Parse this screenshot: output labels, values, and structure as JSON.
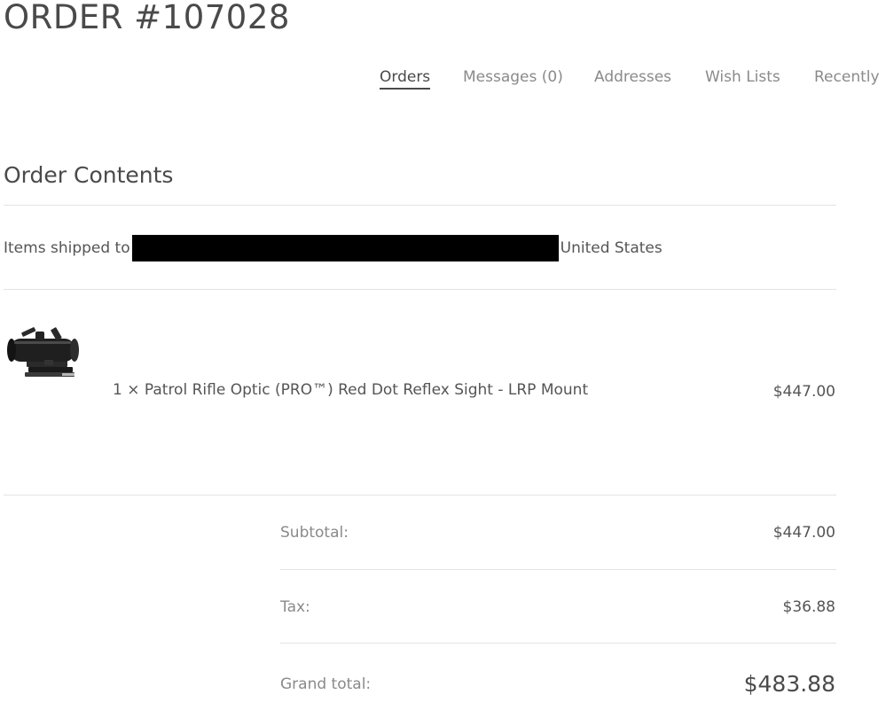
{
  "page": {
    "title": "ORDER #107028"
  },
  "account_nav": {
    "items": [
      {
        "label": "Orders",
        "active": true
      },
      {
        "label": "Messages (0)",
        "active": false
      },
      {
        "label": "Addresses",
        "active": false
      },
      {
        "label": "Wish Lists",
        "active": false
      },
      {
        "label": "Recently",
        "active": false
      }
    ]
  },
  "order_contents": {
    "heading": "Order Contents",
    "shipped_to_label": "Items shipped to",
    "shipped_to_country": "United States",
    "address_redacted": true,
    "items": [
      {
        "quantity_name": "1 × Patrol Rifle Optic (PRO™) Red Dot Reflex Sight - LRP Mount",
        "price": "$447.00",
        "image": "red-dot-sight-thumbnail"
      }
    ]
  },
  "totals": {
    "subtotal_label": "Subtotal:",
    "subtotal_value": "$447.00",
    "tax_label": "Tax:",
    "tax_value": "$36.88",
    "grand_total_label": "Grand total:",
    "grand_total_value": "$483.88"
  }
}
